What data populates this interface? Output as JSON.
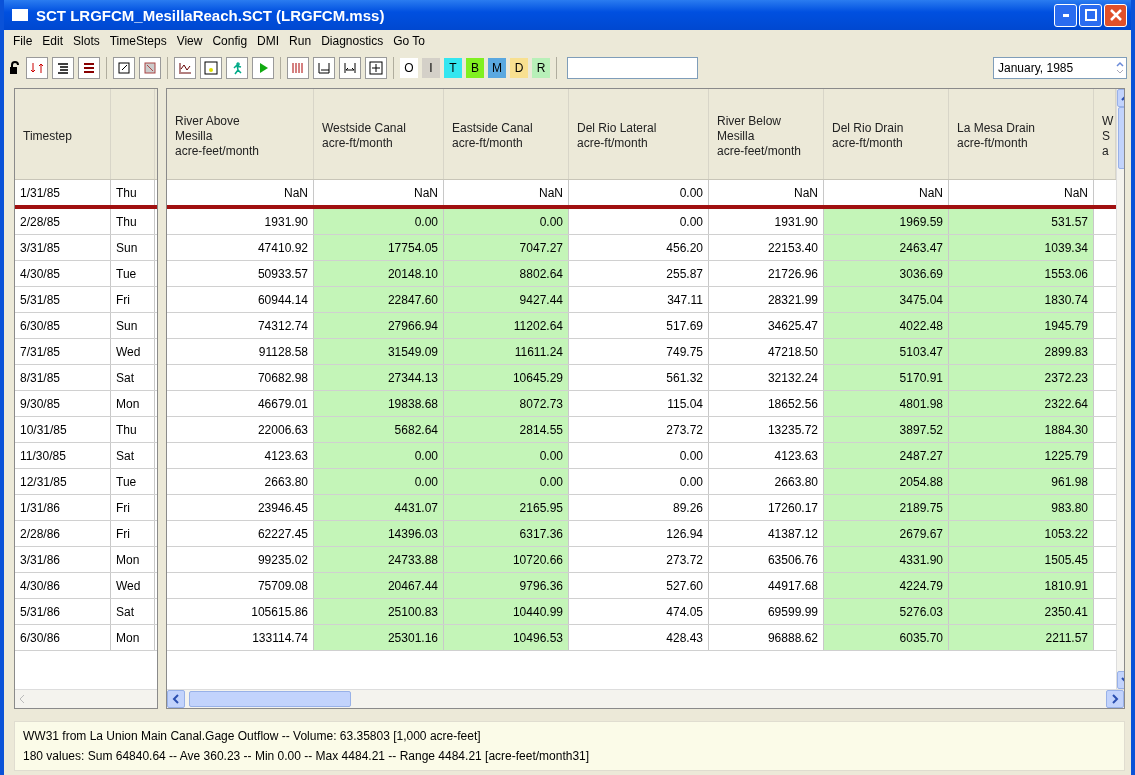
{
  "window": {
    "title": "SCT LRGFCM_MesillaReach.SCT (LRGFCM.mss)"
  },
  "menu": [
    "File",
    "Edit",
    "Slots",
    "TimeSteps",
    "View",
    "Config",
    "DMI",
    "Run",
    "Diagnostics",
    "Go To"
  ],
  "toolbar": {
    "flag_buttons": [
      {
        "label": "O",
        "color": "#ffffff"
      },
      {
        "label": "I",
        "color": "#d4d0c8"
      },
      {
        "label": "T",
        "color": "#33e6f0"
      },
      {
        "label": "B",
        "color": "#80f020"
      },
      {
        "label": "M",
        "color": "#5aa8e0"
      },
      {
        "label": "D",
        "color": "#f8e090"
      },
      {
        "label": "R",
        "color": "#b8f0b8"
      }
    ],
    "date": "January, 1985"
  },
  "table": {
    "timestep_heading": "Timestep",
    "columns": [
      {
        "lines": [
          "River Above",
          "Mesilla",
          "acre-feet/month"
        ],
        "green": false
      },
      {
        "lines": [
          "Westside Canal",
          "acre-ft/month"
        ],
        "green": true
      },
      {
        "lines": [
          "Eastside Canal",
          "acre-ft/month"
        ],
        "green": true
      },
      {
        "lines": [
          "Del Rio Lateral",
          "acre-ft/month"
        ],
        "green": false
      },
      {
        "lines": [
          "River Below",
          "Mesilla",
          "acre-feet/month"
        ],
        "green": false
      },
      {
        "lines": [
          "Del Rio Drain",
          "acre-ft/month"
        ],
        "green": true
      },
      {
        "lines": [
          "La Mesa Drain",
          "acre-ft/month"
        ],
        "green": true
      },
      {
        "lines": [
          "W",
          "S",
          "a"
        ]
      }
    ],
    "initial_row": {
      "date": "1/31/85",
      "day": "Thu",
      "values": [
        "NaN",
        "NaN",
        "NaN",
        "0.00",
        "NaN",
        "NaN",
        "NaN"
      ]
    },
    "rows": [
      {
        "date": "2/28/85",
        "day": "Thu",
        "values": [
          "1931.90",
          "0.00",
          "0.00",
          "0.00",
          "1931.90",
          "1969.59",
          "531.57"
        ]
      },
      {
        "date": "3/31/85",
        "day": "Sun",
        "values": [
          "47410.92",
          "17754.05",
          "7047.27",
          "456.20",
          "22153.40",
          "2463.47",
          "1039.34"
        ]
      },
      {
        "date": "4/30/85",
        "day": "Tue",
        "values": [
          "50933.57",
          "20148.10",
          "8802.64",
          "255.87",
          "21726.96",
          "3036.69",
          "1553.06"
        ]
      },
      {
        "date": "5/31/85",
        "day": "Fri",
        "values": [
          "60944.14",
          "22847.60",
          "9427.44",
          "347.11",
          "28321.99",
          "3475.04",
          "1830.74"
        ]
      },
      {
        "date": "6/30/85",
        "day": "Sun",
        "values": [
          "74312.74",
          "27966.94",
          "11202.64",
          "517.69",
          "34625.47",
          "4022.48",
          "1945.79"
        ]
      },
      {
        "date": "7/31/85",
        "day": "Wed",
        "values": [
          "91128.58",
          "31549.09",
          "11611.24",
          "749.75",
          "47218.50",
          "5103.47",
          "2899.83"
        ]
      },
      {
        "date": "8/31/85",
        "day": "Sat",
        "values": [
          "70682.98",
          "27344.13",
          "10645.29",
          "561.32",
          "32132.24",
          "5170.91",
          "2372.23"
        ]
      },
      {
        "date": "9/30/85",
        "day": "Mon",
        "values": [
          "46679.01",
          "19838.68",
          "8072.73",
          "115.04",
          "18652.56",
          "4801.98",
          "2322.64"
        ]
      },
      {
        "date": "10/31/85",
        "day": "Thu",
        "values": [
          "22006.63",
          "5682.64",
          "2814.55",
          "273.72",
          "13235.72",
          "3897.52",
          "1884.30"
        ]
      },
      {
        "date": "11/30/85",
        "day": "Sat",
        "values": [
          "4123.63",
          "0.00",
          "0.00",
          "0.00",
          "4123.63",
          "2487.27",
          "1225.79"
        ]
      },
      {
        "date": "12/31/85",
        "day": "Tue",
        "values": [
          "2663.80",
          "0.00",
          "0.00",
          "0.00",
          "2663.80",
          "2054.88",
          "961.98"
        ]
      },
      {
        "date": "1/31/86",
        "day": "Fri",
        "values": [
          "23946.45",
          "4431.07",
          "2165.95",
          "89.26",
          "17260.17",
          "2189.75",
          "983.80"
        ]
      },
      {
        "date": "2/28/86",
        "day": "Fri",
        "values": [
          "62227.45",
          "14396.03",
          "6317.36",
          "126.94",
          "41387.12",
          "2679.67",
          "1053.22"
        ]
      },
      {
        "date": "3/31/86",
        "day": "Mon",
        "values": [
          "99235.02",
          "24733.88",
          "10720.66",
          "273.72",
          "63506.76",
          "4331.90",
          "1505.45"
        ]
      },
      {
        "date": "4/30/86",
        "day": "Wed",
        "values": [
          "75709.08",
          "20467.44",
          "9796.36",
          "527.60",
          "44917.68",
          "4224.79",
          "1810.91"
        ]
      },
      {
        "date": "5/31/86",
        "day": "Sat",
        "values": [
          "105615.86",
          "25100.83",
          "10440.99",
          "474.05",
          "69599.99",
          "5276.03",
          "2350.41"
        ]
      },
      {
        "date": "6/30/86",
        "day": "Mon",
        "values": [
          "133114.74",
          "25301.16",
          "10496.53",
          "428.43",
          "96888.62",
          "6035.70",
          "2211.57"
        ]
      }
    ]
  },
  "status": [
    "WW31 from La Union Main Canal.Gage Outflow -- Volume: 63.35803 [1,000 acre-feet]",
    "180 values:  Sum 64840.64 -- Ave 360.23 -- Min 0.00 -- Max 4484.21 -- Range 4484.21 [acre-feet/month31]"
  ]
}
